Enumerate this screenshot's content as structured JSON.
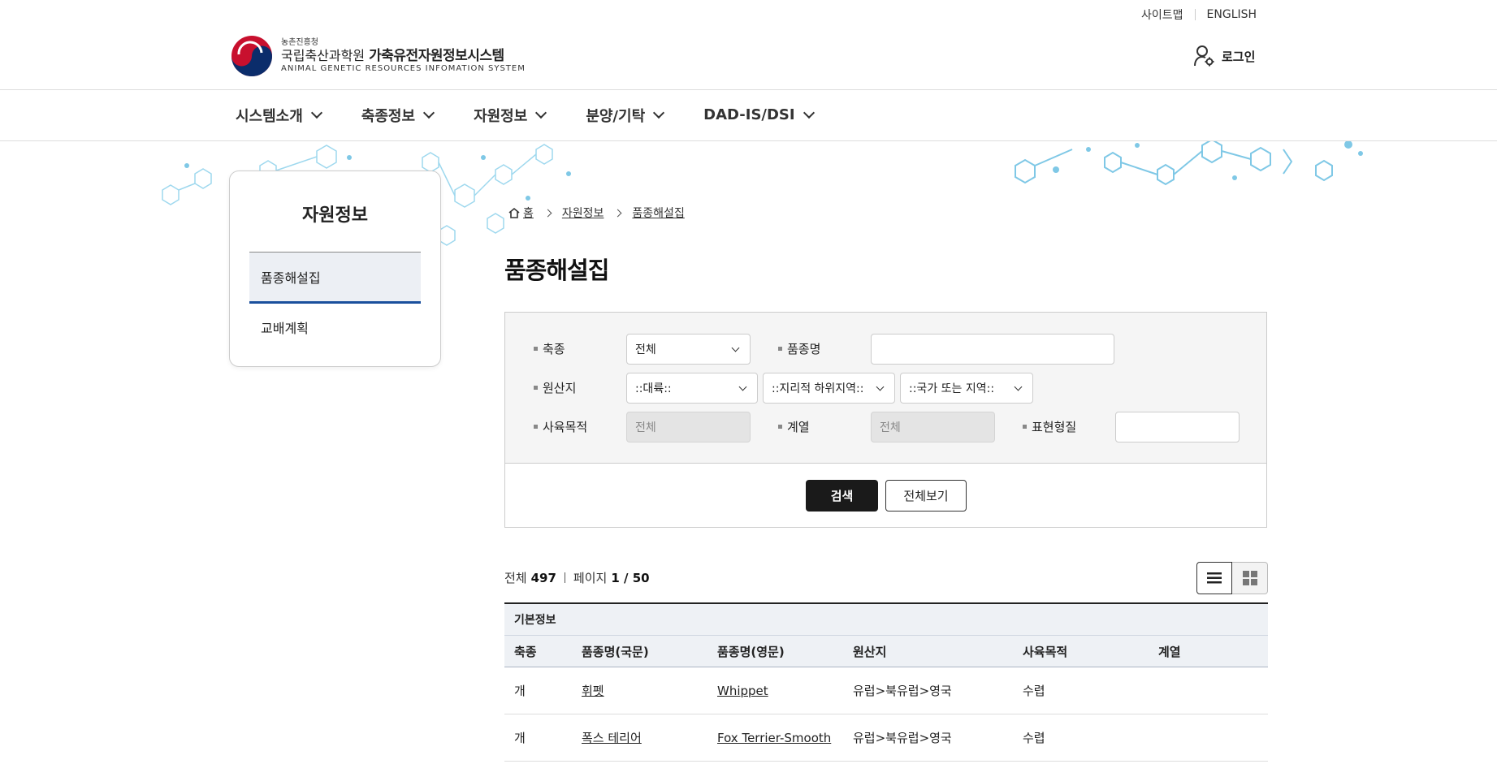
{
  "utility": {
    "sitemap": "사이트맵",
    "english": "ENGLISH"
  },
  "logo": {
    "org_small": "농촌진흥청",
    "org_main": "국립축산과학원",
    "system_name": "가축유전자원정보시스템",
    "system_eng": "ANIMAL GENETIC RESOURCES INFOMATION SYSTEM"
  },
  "header": {
    "login": "로그인"
  },
  "gnb": [
    "시스템소개",
    "축종정보",
    "자원정보",
    "분양/기탁",
    "DAD-IS/DSI"
  ],
  "side": {
    "title": "자원정보",
    "items": [
      "품종해설집",
      "교배계획"
    ]
  },
  "breadcrumb": {
    "home": "홈",
    "level1": "자원정보",
    "level2": "품종해설집"
  },
  "page_title": "품종해설집",
  "search": {
    "species_label": "축종",
    "species_value": "전체",
    "breed_name_label": "품종명",
    "origin_label": "원산지",
    "continent_value": "::대륙::",
    "subregion_value": "::지리적 하위지역::",
    "country_value": "::국가 또는 지역::",
    "purpose_label": "사육목적",
    "purpose_value": "전체",
    "lineage_label": "계열",
    "lineage_value": "전체",
    "phenotype_label": "표현형질",
    "search_button": "검색",
    "view_all_button": "전체보기"
  },
  "summary": {
    "total_label": "전체",
    "total": "497",
    "page_label": "페이지",
    "page": "1 / 50"
  },
  "table": {
    "group": "기본정보",
    "headers": [
      "축종",
      "품종명(국문)",
      "품종명(영문)",
      "원산지",
      "사육목적",
      "계열"
    ],
    "rows": [
      {
        "species": "개",
        "name_ko": "휘펫",
        "name_en": "Whippet",
        "origin": "유럽>북유럽>영국",
        "purpose": "수렵",
        "lineage": ""
      },
      {
        "species": "개",
        "name_ko": "폭스 테리어",
        "name_en": "Fox Terrier-Smooth",
        "origin": "유럽>북유럽>영국",
        "purpose": "수렵",
        "lineage": ""
      }
    ]
  },
  "colors": {
    "accent": "#1a4f9c",
    "button_dark": "#1a1a1a",
    "decor": "#7fc8e6"
  }
}
